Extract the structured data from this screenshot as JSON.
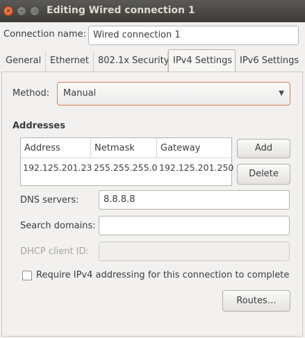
{
  "window": {
    "title": "Editing Wired connection 1",
    "close_glyph": "×",
    "min_glyph": "–",
    "max_glyph": "▫"
  },
  "connection": {
    "name_label": "Connection name:",
    "name_value": "Wired connection 1"
  },
  "tabs": [
    {
      "label": "General",
      "active": false
    },
    {
      "label": "Ethernet",
      "active": false
    },
    {
      "label": "802.1x Security",
      "active": false
    },
    {
      "label": "IPv4 Settings",
      "active": true
    },
    {
      "label": "IPv6 Settings",
      "active": false
    }
  ],
  "ipv4": {
    "method_label": "Method:",
    "method_value": "Manual",
    "dropdown_arrow": "▼",
    "addresses_title": "Addresses",
    "table": {
      "headers": [
        "Address",
        "Netmask",
        "Gateway"
      ],
      "rows": [
        [
          "192.125.201.23",
          "255.255.255.0",
          "192.125.201.250"
        ]
      ]
    },
    "add_label": "Add",
    "delete_label": "Delete",
    "dns_label": "DNS servers:",
    "dns_value": "8.8.8.8",
    "search_label": "Search domains:",
    "search_value": "",
    "dhcp_label": "DHCP client ID:",
    "dhcp_value": "",
    "require_label": "Require IPv4 addressing for this connection to complete",
    "require_checked": false,
    "routes_label": "Routes…"
  },
  "colors": {
    "titlebar": "#3c3b37",
    "close_button": "#e0511d",
    "focus_border": "#e07a52",
    "window_bg": "#f2f1f0"
  }
}
